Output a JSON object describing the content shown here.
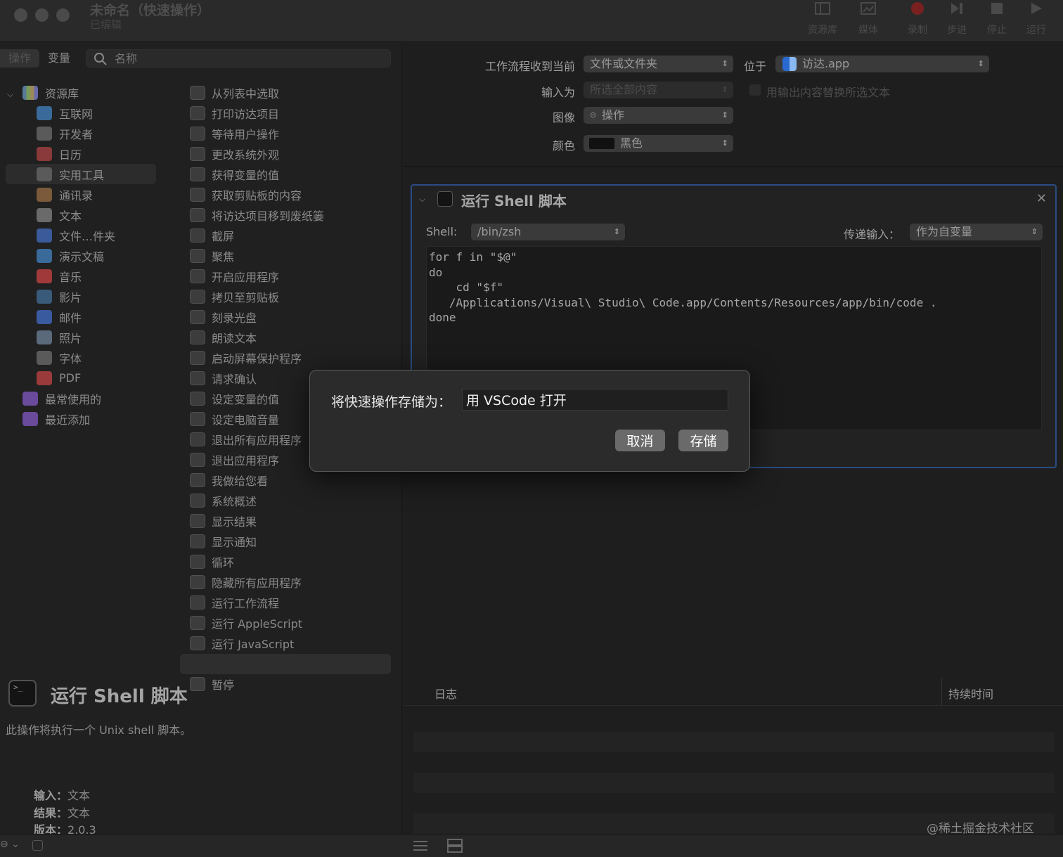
{
  "window": {
    "title": "未命名（快速操作）",
    "subtitle": "已编辑"
  },
  "toolbar": [
    {
      "label": "资源库",
      "icon": "sidebar-icon"
    },
    {
      "label": "媒体",
      "icon": "media-icon"
    },
    {
      "label": "录制",
      "icon": "record-icon"
    },
    {
      "label": "步进",
      "icon": "step-icon"
    },
    {
      "label": "停止",
      "icon": "stop-icon"
    },
    {
      "label": "运行",
      "icon": "run-icon"
    }
  ],
  "left_tabs": {
    "actions": "操作",
    "variables": "变量"
  },
  "search": {
    "placeholder": "名称"
  },
  "library": {
    "root": "资源库",
    "items": [
      "互联网",
      "开发者",
      "日历",
      "实用工具",
      "通讯录",
      "文本",
      "文件…件夹",
      "演示文稿",
      "音乐",
      "影片",
      "邮件",
      "照片",
      "字体",
      "PDF"
    ],
    "smart": [
      "最常使用的",
      "最近添加"
    ]
  },
  "actions_list": [
    "从列表中选取",
    "打印访达项目",
    "等待用户操作",
    "更改系统外观",
    "获得变量的值",
    "获取剪贴板的内容",
    "将访达项目移到废纸篓",
    "截屏",
    "聚焦",
    "开启应用程序",
    "拷贝至剪贴板",
    "刻录光盘",
    "朗读文本",
    "启动屏幕保护程序",
    "请求确认",
    "设定变量的值",
    "设定电脑音量",
    "退出所有应用程序",
    "退出应用程序",
    "我做给您看",
    "系统概述",
    "显示结果",
    "显示通知",
    "循环",
    "隐藏所有应用程序",
    "运行工作流程",
    "运行 AppleScript",
    "运行 JavaScript",
    "运行 Shell 脚本",
    "暂停"
  ],
  "description": {
    "title": "运行 Shell 脚本",
    "text": "此操作将执行一个 Unix shell 脚本。",
    "input_label": "输入：",
    "input_value": "文本",
    "result_label": "结果：",
    "result_value": "文本",
    "version_label": "版本：",
    "version_value": "2.0.3"
  },
  "workflow": {
    "receives_label": "工作流程收到当前",
    "receives_value": "文件或文件夹",
    "in_label": "位于",
    "in_value": "访达.app",
    "input_is_label": "输入为",
    "input_is_value": "所选全部内容",
    "replace_label": "用输出内容替换所选文本",
    "image_label": "图像",
    "image_value": "操作",
    "color_label": "颜色",
    "color_value": "黑色"
  },
  "action_panel": {
    "title": "运行 Shell 脚本",
    "shell_label": "Shell:",
    "shell_value": "/bin/zsh",
    "pass_label": "传递输入：",
    "pass_value": "作为自变量",
    "code": "for f in \"$@\"\ndo\n    cd \"$f\"\n   /Applications/Visual\\ Studio\\ Code.app/Contents/Resources/app/bin/code .\ndone"
  },
  "log": {
    "col_log": "日志",
    "col_duration": "持续时间"
  },
  "dialog": {
    "label": "将快速操作存储为：",
    "value": "用 VSCode 打开",
    "cancel": "取消",
    "save": "存储"
  },
  "watermark": "@稀土掘金技术社区",
  "colors": {
    "accent_border": "#2b4c85",
    "record": "#7a2020"
  }
}
